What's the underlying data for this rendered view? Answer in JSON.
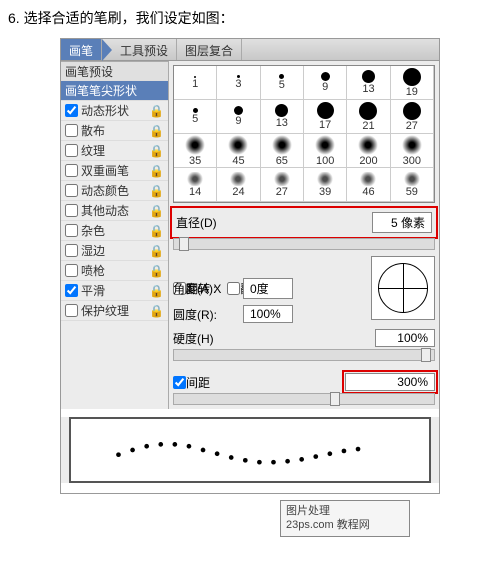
{
  "caption": "6. 选择合适的笔刷，我们设定如图：",
  "tabs": {
    "brush": "画笔",
    "tool_presets": "工具预设",
    "layer_comps": "图层复合"
  },
  "sidebar": {
    "header": "画笔预设",
    "items": [
      {
        "label": "画笔笔尖形状",
        "selected": true,
        "cb": false
      },
      {
        "label": "动态形状",
        "checked": true,
        "lock": true
      },
      {
        "label": "散布",
        "checked": false,
        "lock": true
      },
      {
        "label": "纹理",
        "checked": false,
        "lock": true
      },
      {
        "label": "双重画笔",
        "checked": false,
        "lock": true
      },
      {
        "label": "动态颜色",
        "checked": false,
        "lock": true
      },
      {
        "label": "其他动态",
        "checked": false,
        "lock": true
      },
      {
        "label": "杂色",
        "checked": false,
        "lock": true
      },
      {
        "label": "湿边",
        "checked": false,
        "lock": true
      },
      {
        "label": "喷枪",
        "checked": false,
        "lock": true
      },
      {
        "label": "平滑",
        "checked": true,
        "lock": true
      },
      {
        "label": "保护纹理",
        "checked": false,
        "lock": true
      }
    ]
  },
  "brush_presets": [
    {
      "size": 1,
      "type": "hard"
    },
    {
      "size": 3,
      "type": "hard"
    },
    {
      "size": 5,
      "type": "hard"
    },
    {
      "size": 9,
      "type": "hard"
    },
    {
      "size": 13,
      "type": "hard"
    },
    {
      "size": 19,
      "type": "hard"
    },
    {
      "size": 5,
      "type": "hard"
    },
    {
      "size": 9,
      "type": "hard"
    },
    {
      "size": 13,
      "type": "hard"
    },
    {
      "size": 17,
      "type": "hard"
    },
    {
      "size": 21,
      "type": "hard"
    },
    {
      "size": 27,
      "type": "hard"
    },
    {
      "size": 35,
      "type": "soft"
    },
    {
      "size": 45,
      "type": "soft"
    },
    {
      "size": 65,
      "type": "soft"
    },
    {
      "size": 100,
      "type": "soft"
    },
    {
      "size": 200,
      "type": "soft"
    },
    {
      "size": 300,
      "type": "soft"
    },
    {
      "size": 14,
      "type": "tex"
    },
    {
      "size": 24,
      "type": "tex"
    },
    {
      "size": 27,
      "type": "tex"
    },
    {
      "size": 39,
      "type": "tex"
    },
    {
      "size": 46,
      "type": "tex"
    },
    {
      "size": 59,
      "type": "tex"
    }
  ],
  "controls": {
    "diameter_label": "直径(D)",
    "diameter_value": "5 像素",
    "flip_x": "翻转 X",
    "flip_y": "翻转 Y",
    "angle_label": "角度(A):",
    "angle_value": "0度",
    "roundness_label": "圆度(R):",
    "roundness_value": "100%",
    "hardness_label": "硬度(H)",
    "hardness_value": "100%",
    "spacing_label": "间距",
    "spacing_value": "300%"
  },
  "watermark": {
    "line1": "图片处理",
    "line2": "23ps.com 教程网"
  }
}
